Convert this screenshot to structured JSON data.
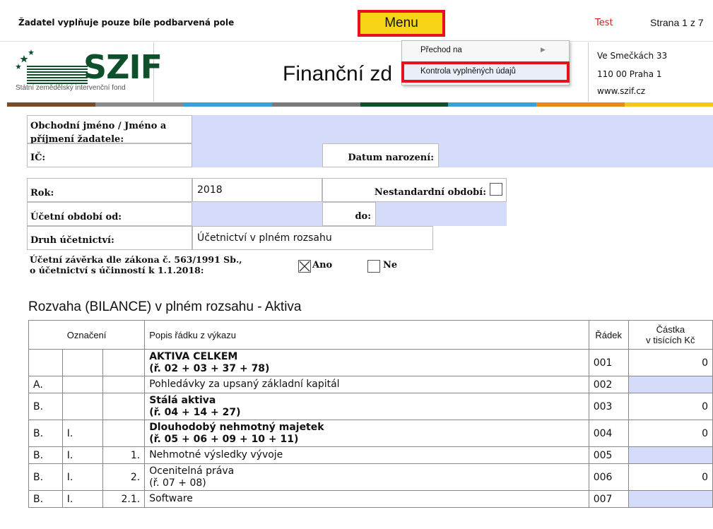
{
  "topbar": {
    "notice": "Žadatel vyplňuje pouze bíle podbarvená pole",
    "menu_label": "Menu",
    "test_label": "Test",
    "page_label": "Strana 1 z 7"
  },
  "dropdown": {
    "item1": "Přechod na",
    "item2": "Kontrola vyplněných údajů"
  },
  "header": {
    "logo_text": "SZIF",
    "logo_sub": "Státní zemědělský intervenční fond",
    "title": "Finanční zd",
    "address": [
      "Ve Smečkách 33",
      "110 00 Praha 1",
      "www.szif.cz"
    ]
  },
  "stripe_colors": [
    "#7a4a2a",
    "#8a8a8a",
    "#3aa0d8",
    "#7a7a7a",
    "#0e4f2c",
    "#3aa0d8",
    "#e88a1a",
    "#f2c81a"
  ],
  "form": {
    "name_label": "Obchodní jméno / Jméno a příjmení žadatele:",
    "ic_label": "IČ:",
    "birth_label": "Datum narození:",
    "year_label": "Rok:",
    "year_value": "2018",
    "nonstandard_label": "Nestandardní období:",
    "period_from_label": "Účetní období od:",
    "period_to_label": "do:",
    "accounting_label": "Druh účetnictví:",
    "accounting_value": "Účetnictví v plném rozsahu",
    "closing_label_1": "Účetní závěrka dle zákona č. 563/1991 Sb.,",
    "closing_label_2": "o účetnictví s účinností k 1.1.2018:",
    "yes_label": "Ano",
    "no_label": "Ne",
    "yes_checked": true,
    "no_checked": false
  },
  "table": {
    "title": "Rozvaha (BILANCE) v plném rozsahu - Aktiva",
    "headers": {
      "designation": "Označení",
      "description": "Popis řádku z výkazu",
      "row": "Řádek",
      "amount_1": "Částka",
      "amount_2": "v tisících Kč"
    },
    "rows": [
      {
        "c1": "",
        "c2": "",
        "c3": "",
        "desc1": "AKTIVA CELKEM",
        "desc2": "(ř. 02 + 03 + 37 + 78)",
        "bold": true,
        "row": "001",
        "amount": "0",
        "fill": false
      },
      {
        "c1": "A.",
        "c2": "",
        "c3": "",
        "desc1": "Pohledávky za upsaný základní kapitál",
        "desc2": "",
        "bold": false,
        "row": "002",
        "amount": "",
        "fill": true
      },
      {
        "c1": "B.",
        "c2": "",
        "c3": "",
        "desc1": "Stálá aktiva",
        "desc2": "(ř. 04 + 14 + 27)",
        "bold": true,
        "row": "003",
        "amount": "0",
        "fill": false
      },
      {
        "c1": "B.",
        "c2": "I.",
        "c3": "",
        "desc1": "Dlouhodobý nehmotný majetek",
        "desc2": "(ř. 05 + 06 + 09 + 10 + 11)",
        "bold": true,
        "row": "004",
        "amount": "0",
        "fill": false
      },
      {
        "c1": "B.",
        "c2": "I.",
        "c3": "1.",
        "desc1": "Nehmotné výsledky vývoje",
        "desc2": "",
        "bold": false,
        "row": "005",
        "amount": "",
        "fill": true
      },
      {
        "c1": "B.",
        "c2": "I.",
        "c3": "2.",
        "desc1": "Ocenitelná práva",
        "desc2": "(ř. 07 + 08)",
        "bold": false,
        "row": "006",
        "amount": "0",
        "fill": false
      },
      {
        "c1": "B.",
        "c2": "I.",
        "c3": "2.1.",
        "desc1": "Software",
        "desc2": "",
        "bold": false,
        "row": "007",
        "amount": "",
        "fill": true
      }
    ]
  }
}
